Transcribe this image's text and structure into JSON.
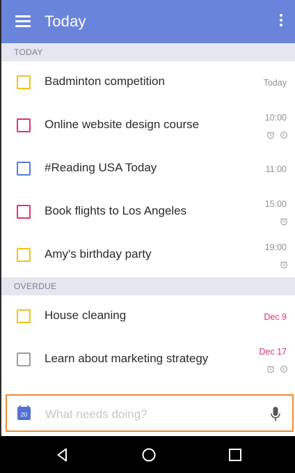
{
  "appbar": {
    "title": "Today",
    "background": "#6a84dc",
    "left_icon": "menu-icon",
    "right_icon": "more-vert-icon"
  },
  "sections": [
    {
      "header": "TODAY",
      "tasks": [
        {
          "title": "Badminton competition",
          "time": "Today",
          "priority_color": "#f2c21b",
          "icons": []
        },
        {
          "title": "Online website design course",
          "time": "10:00",
          "priority_color": "#e0336f",
          "icons": [
            "alarm-icon",
            "repeat-icon"
          ]
        },
        {
          "title": "#Reading  USA Today",
          "time": "11:00",
          "priority_color": "#5a7bd8",
          "icons": []
        },
        {
          "title": "Book flights to Los Angeles",
          "time": "15:00",
          "priority_color": "#e0336f",
          "icons": [
            "alarm-icon"
          ]
        },
        {
          "title": "Amy's birthday party",
          "time": "19:00",
          "priority_color": "#f2c21b",
          "icons": [
            "alarm-icon"
          ]
        }
      ]
    },
    {
      "header": "OVERDUE",
      "tasks": [
        {
          "title": "House cleaning",
          "time": "Dec 9",
          "time_color": "#e0336f",
          "priority_color": "#f2c21b",
          "icons": []
        },
        {
          "title": "Learn about marketing strategy",
          "time": "Dec 17",
          "time_color": "#e0336f",
          "priority_color": "#9e9e9e",
          "icons": [
            "alarm-icon",
            "repeat-icon"
          ]
        }
      ]
    }
  ],
  "add_bar": {
    "placeholder": "What needs doing?",
    "calendar_icon_day": "20",
    "calendar_icon": "calendar-icon",
    "mic_icon": "microphone-icon",
    "border_color": "#f08a2f"
  },
  "navbar": {
    "buttons": [
      "back-icon",
      "home-icon",
      "recents-icon"
    ]
  }
}
